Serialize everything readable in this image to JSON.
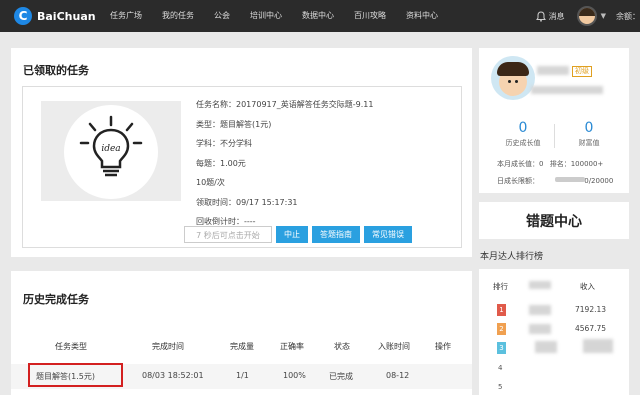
{
  "logo": {
    "mark": "C",
    "text": "BaiChuan"
  },
  "nav": [
    "任务广场",
    "我的任务",
    "公会",
    "培训中心",
    "数据中心",
    "百川攻略",
    "资料中心"
  ],
  "top_right": {
    "messages_label": "消息",
    "balance_label": "余额："
  },
  "current_task": {
    "title": "已领取的任务",
    "illustration_text": "idea",
    "info": [
      "任务名称：20170917_英语解答任务交际题-9.11",
      "类型：题目解答(1元)",
      "学科：不分学科",
      "每题：1.00元",
      "10题/次",
      "领取时间：09/17 15:17:31",
      "回收倒计时：----"
    ],
    "buttons": {
      "wait": "7 秒后可点击开始",
      "stop": "中止",
      "guide": "答题指南",
      "faq": "常见错误"
    }
  },
  "history": {
    "title": "历史完成任务",
    "columns": [
      "任务类型",
      "完成时间",
      "完成量",
      "正确率",
      "状态",
      "入账时间",
      "操作"
    ],
    "rows": [
      {
        "type": "题目解答(1.5元)",
        "time": "08/03 18:52:01",
        "amount": "1/1",
        "rate": "100%",
        "status": "已完成",
        "date": "08-12",
        "action": ""
      }
    ]
  },
  "profile": {
    "level_badge": "初级",
    "growth_value": "0",
    "growth_label": "历史成长值",
    "wealth_value": "0",
    "wealth_label": "财富值",
    "month_growth": "本月成长值：0",
    "rank_text": "排名：100000+",
    "daily_limit_label": "日成长限额：",
    "daily_limit_value": "0/20000"
  },
  "error_center": {
    "label": "错题中心"
  },
  "ranking": {
    "title": "本月达人排行榜",
    "headers": {
      "rank": "排行",
      "income": "收入"
    },
    "rows": [
      {
        "rank": "1",
        "color": "#e05a4a",
        "income": "7192.13"
      },
      {
        "rank": "2",
        "color": "#f0a050",
        "income": "4567.75"
      },
      {
        "rank": "3",
        "color": "#5bc0de",
        "income": ""
      },
      {
        "rank": "4",
        "color": "",
        "income": ""
      },
      {
        "rank": "5",
        "color": "",
        "income": ""
      }
    ]
  }
}
